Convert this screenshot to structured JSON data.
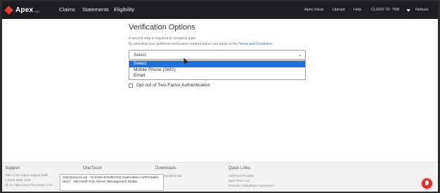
{
  "nav": {
    "logo_text": "Apex",
    "logo_sub": "EDI",
    "main_items": [
      "Claims",
      "Statements",
      "Eligibility"
    ],
    "right_items": [
      "Apex Inbox",
      "Upload",
      "Help",
      "CLIENT ID: TNB",
      "Notices"
    ]
  },
  "page": {
    "title": "Verification Options",
    "subtitle": "A second step is required to complete login.",
    "agreement_prefix": "By selecting your preferred verification method below you agree to the",
    "agreement_link": "Terms and Conditions"
  },
  "verification_select": {
    "value": "Select",
    "options": [
      "Select",
      "Mobile Phone (SMS)",
      "Email"
    ],
    "highlighted_index": 0
  },
  "opt_out": {
    "label": "Opt out of Two-Factor Authentication",
    "checked": false
  },
  "footer": {
    "support": {
      "heading": "Support",
      "lines": [
        "Talk to our expert support staff.",
        "1 (800) 8888 4432",
        "St. Lt. Apex Issue Resolution Line"
      ]
    },
    "onetouch": {
      "heading": "OneTouch"
    },
    "downloads": {
      "heading": "Downloads",
      "lines": [
        "OneClaims NS"
      ]
    },
    "quick_links": {
      "heading": "Quick Links",
      "lines": [
        "Add New Provider",
        "Spec Price List",
        "Provider Amendment Agreement"
      ]
    }
  },
  "taskbar_tooltip": {
    "text": "SQLQuery11.sql - CL2AMAZ-IKINCGQ.ClaimValue (APEX\\askin (51))* - Microsoft SQL Server Management Studio"
  },
  "colors": {
    "nav_bg": "#1c1e21",
    "link": "#3a76c4",
    "option_highlight": "#1e6fd9",
    "help_bubble": "#d43030"
  }
}
